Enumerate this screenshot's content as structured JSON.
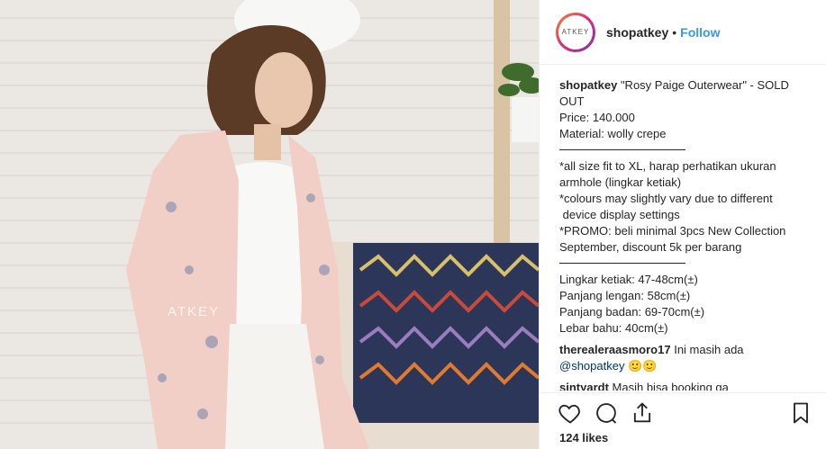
{
  "header": {
    "avatar_text": "ATKEY",
    "username": "shopatkey",
    "dot": "•",
    "follow_label": "Follow"
  },
  "photo": {
    "watermark": "ATKEY"
  },
  "caption": {
    "username": "shopatkey",
    "title": "\"Rosy Paige Outerwear\" - SOLD OUT",
    "price": "Price: 140.000",
    "material": "Material: wolly crepe",
    "notes": [
      "*all size fit to XL, harap perhatikan ukuran armhole (lingkar ketiak)",
      "*colours may slightly vary due to different\n device display settings",
      "*PROMO: beli minimal 3pcs New Collection September, discount 5k per barang"
    ],
    "measurements": [
      "Lingkar ketiak: 47-48cm(±)",
      "Panjang lengan: 58cm(±)",
      "Panjang badan: 69-70cm(±)",
      "Lebar bahu: 40cm(±)"
    ]
  },
  "comments": [
    {
      "user": "therealeraasmoro17",
      "text": "Ini masih ada",
      "mention": "@shopatkey",
      "emoji": "🙂🙂"
    },
    {
      "user": "sintyardt",
      "text": "Masih bisa booking ga"
    }
  ],
  "actions": {
    "icons": [
      "heart-icon",
      "comment-icon",
      "share-icon",
      "bookmark-icon"
    ]
  },
  "likes": "124 likes",
  "colors": {
    "follow": "#3897f0",
    "text": "#262626",
    "border": "#efefef"
  }
}
